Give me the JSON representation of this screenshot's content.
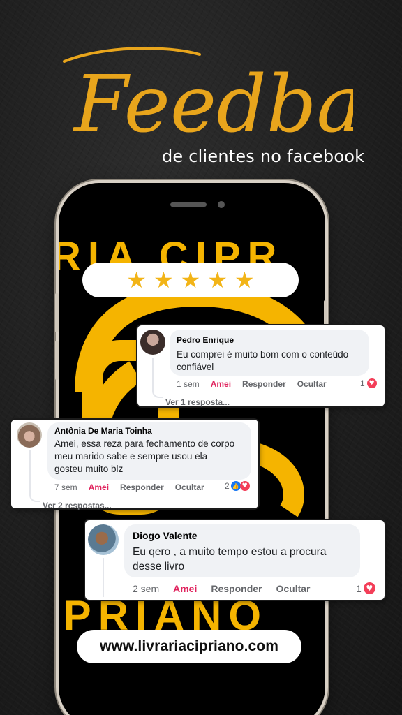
{
  "header": {
    "title": "Feedback",
    "subtitle": "de clientes no facebook"
  },
  "colors": {
    "gold": "#e8a51c",
    "brand_yellow": "#f5b400",
    "amei": "#e0245e",
    "heart": "#f33e58",
    "like": "#1877f2"
  },
  "phone_art": {
    "top_text": "RIA CIPR",
    "bottom_text": "IPRIANO"
  },
  "rating": {
    "stars": 5,
    "icon": "star-icon"
  },
  "comments": [
    {
      "author": "Pedro Enrique",
      "text_line1": "Eu comprei é muito bom com o conteúdo",
      "text_line2": "confiável",
      "time": "1 sem",
      "amei": "Amei",
      "reply": "Responder",
      "hide": "Ocultar",
      "reactions": "1",
      "replies_link": "Ver 1 resposta..."
    },
    {
      "author": "Antônia De Maria Toinha",
      "text_line1": "Amei, essa reza para fechamento de corpo",
      "text_line2": "meu marido sabe e sempre usou ela",
      "text_line3": "gosteu muito blz",
      "time": "7 sem",
      "amei": "Amei",
      "reply": "Responder",
      "hide": "Ocultar",
      "reactions": "2",
      "replies_link": "Ver 2 respostas..."
    },
    {
      "author": "Diogo Valente",
      "text_line1": "Eu qero , a muito tempo estou a procura",
      "text_line2": "desse livro",
      "time": "2 sem",
      "amei": "Amei",
      "reply": "Responder",
      "hide": "Ocultar",
      "reactions": "1"
    }
  ],
  "footer": {
    "url": "www.livrariacipriano.com"
  }
}
